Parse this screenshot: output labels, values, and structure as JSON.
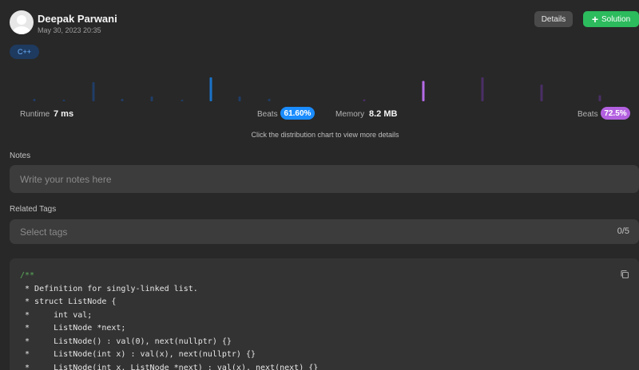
{
  "user": {
    "name": "Deepak Parwani",
    "date": "May 30, 2023 20:35"
  },
  "actions": {
    "details_label": "Details",
    "solution_label": "Solution",
    "solution_icon": "plus-icon"
  },
  "language_tag": "C++",
  "distribution": {
    "runtime_bars": [
      0.1,
      0.05,
      0.8,
      0.1,
      0.2,
      0.05,
      1.0,
      0.2,
      0.1
    ],
    "runtime_highlight_index": 6,
    "memory_bars": [
      0.08,
      0.85,
      1.0,
      0.7,
      0.25
    ],
    "memory_highlight_index": 1,
    "runtime_color": "#1a73c9",
    "runtime_dim_color": "#1f3d66",
    "memory_color": "#b66be8",
    "memory_dim_color": "#4a2e66"
  },
  "stats": {
    "runtime_label": "Runtime",
    "runtime_value": "7 ms",
    "runtime_beats_label": "Beats",
    "runtime_beats_value": "61.60%",
    "runtime_badge_color": "#1a8cff",
    "memory_label": "Memory",
    "memory_value": "8.2 MB",
    "memory_beats_label": "Beats",
    "memory_beats_value": "72.5%",
    "memory_badge_color": "#b360e0"
  },
  "hint": "Click the distribution chart to view more details",
  "notes": {
    "label": "Notes",
    "placeholder": "Write your notes here"
  },
  "tags": {
    "label": "Related Tags",
    "placeholder": "Select tags",
    "count": "0/5"
  },
  "code": {
    "lines": [
      "/**",
      " * Definition for singly-linked list.",
      " * struct ListNode {",
      " *     int val;",
      " *     ListNode *next;",
      " *     ListNode() : val(0), next(nullptr) {}",
      " *     ListNode(int x) : val(x), next(nullptr) {}",
      " *     ListNode(int x, ListNode *next) : val(x), next(next) {}"
    ],
    "copy_icon": "copy-icon"
  }
}
